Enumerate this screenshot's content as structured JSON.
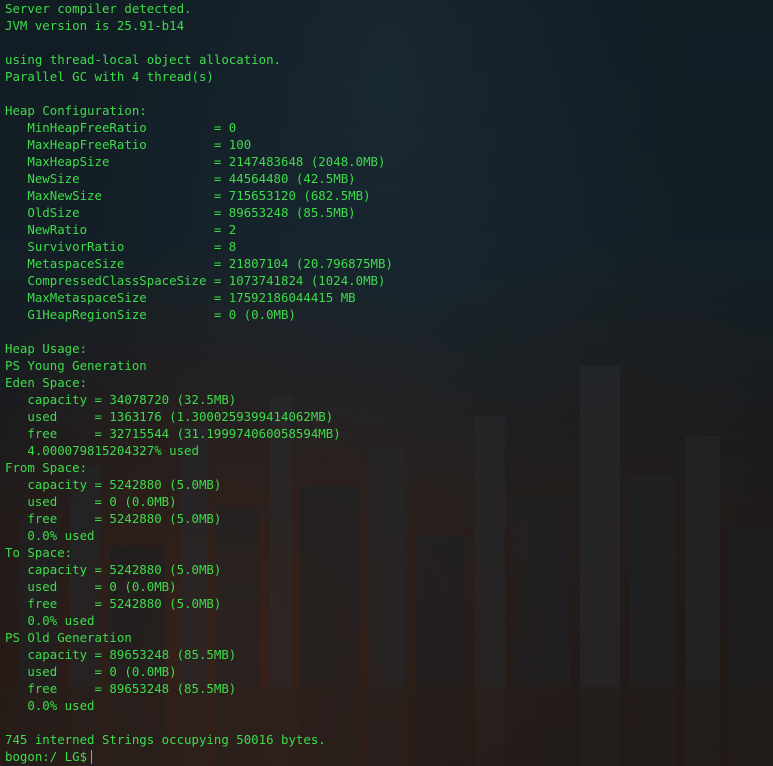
{
  "terminal": {
    "lines": [
      "Server compiler detected.",
      "JVM version is 25.91-b14",
      "",
      "using thread-local object allocation.",
      "Parallel GC with 4 thread(s)",
      "",
      "Heap Configuration:",
      "   MinHeapFreeRatio         = 0",
      "   MaxHeapFreeRatio         = 100",
      "   MaxHeapSize              = 2147483648 (2048.0MB)",
      "   NewSize                  = 44564480 (42.5MB)",
      "   MaxNewSize               = 715653120 (682.5MB)",
      "   OldSize                  = 89653248 (85.5MB)",
      "   NewRatio                 = 2",
      "   SurvivorRatio            = 8",
      "   MetaspaceSize            = 21807104 (20.796875MB)",
      "   CompressedClassSpaceSize = 1073741824 (1024.0MB)",
      "   MaxMetaspaceSize         = 17592186044415 MB",
      "   G1HeapRegionSize         = 0 (0.0MB)",
      "",
      "Heap Usage:",
      "PS Young Generation",
      "Eden Space:",
      "   capacity = 34078720 (32.5MB)",
      "   used     = 1363176 (1.3000259399414062MB)",
      "   free     = 32715544 (31.199974060058594MB)",
      "   4.000079815204327% used",
      "From Space:",
      "   capacity = 5242880 (5.0MB)",
      "   used     = 0 (0.0MB)",
      "   free     = 5242880 (5.0MB)",
      "   0.0% used",
      "To Space:",
      "   capacity = 5242880 (5.0MB)",
      "   used     = 0 (0.0MB)",
      "   free     = 5242880 (5.0MB)",
      "   0.0% used",
      "PS Old Generation",
      "   capacity = 89653248 (85.5MB)",
      "   used     = 0 (0.0MB)",
      "   free     = 89653248 (85.5MB)",
      "   0.0% used",
      "",
      "745 interned Strings occupying 50016 bytes."
    ],
    "prompt": "bogon:/ LG$"
  }
}
